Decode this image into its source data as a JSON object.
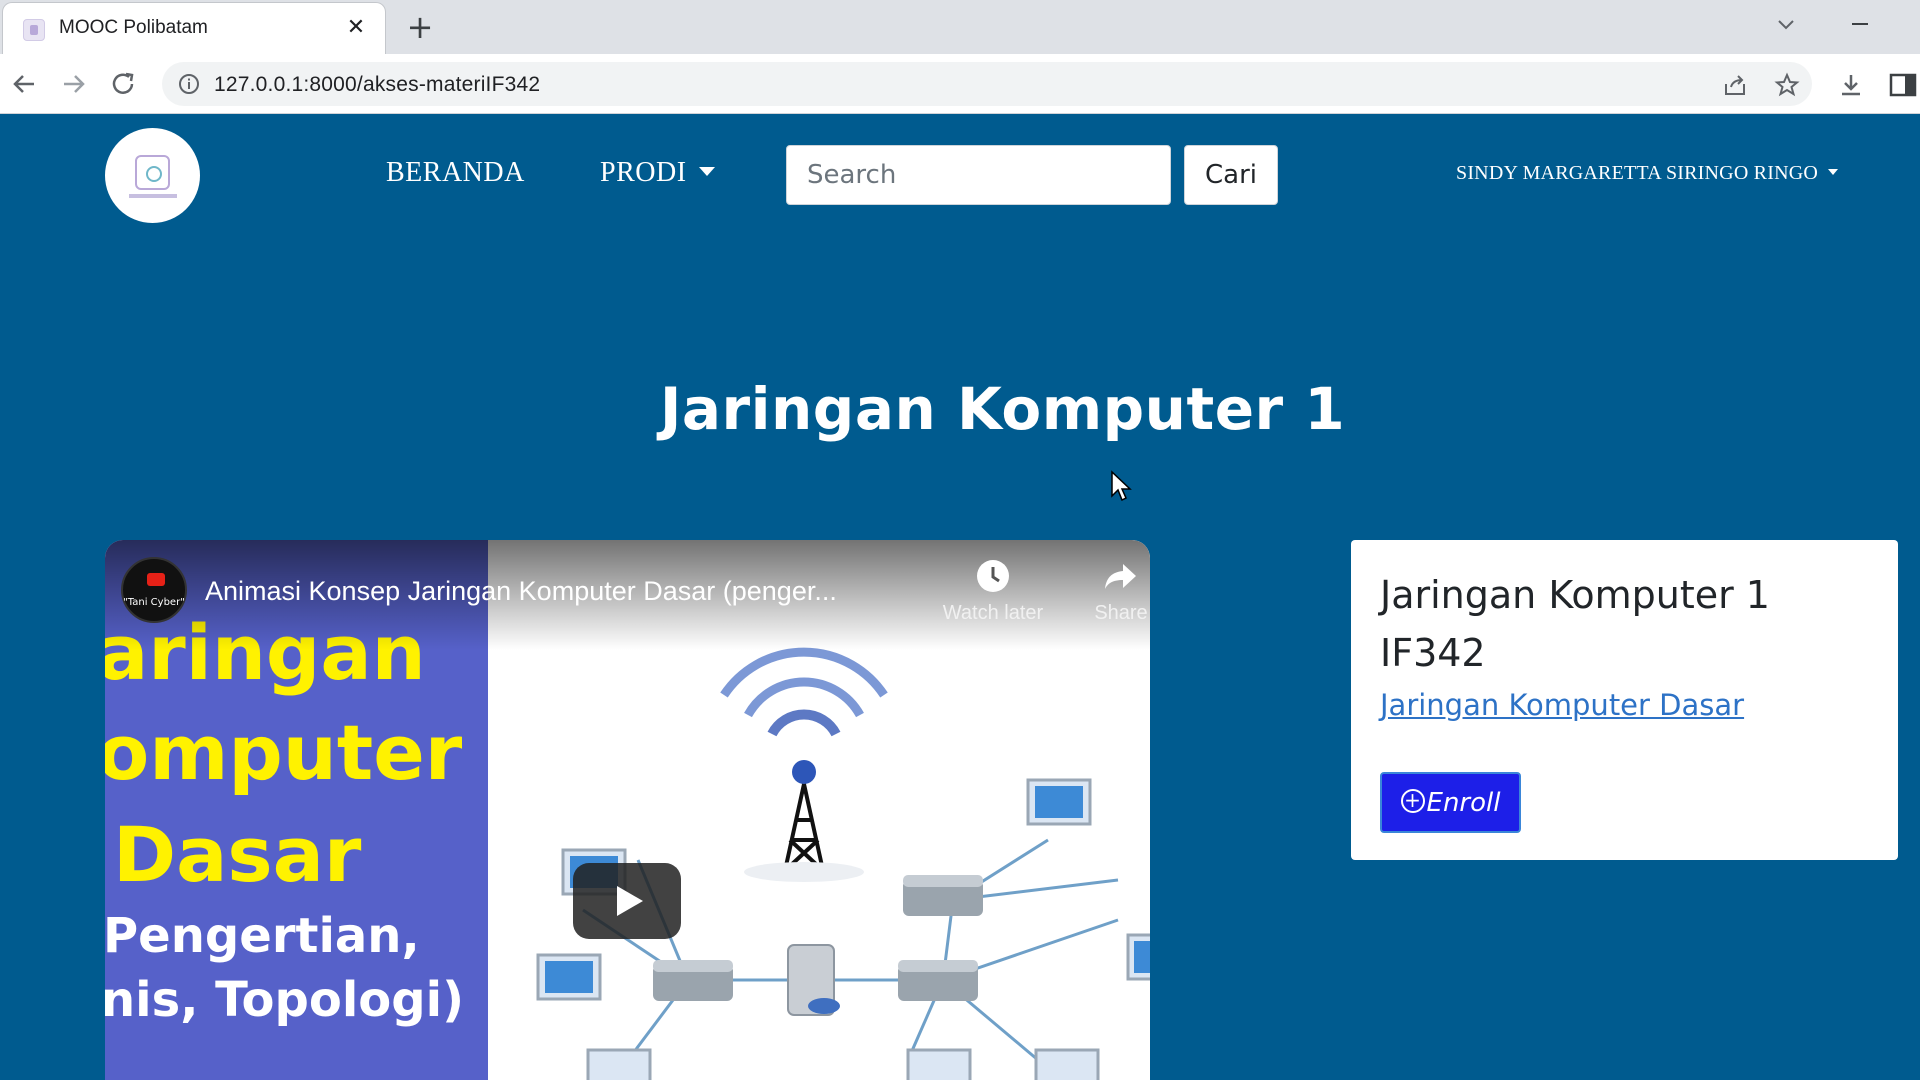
{
  "browser": {
    "tab_title": "MOOC Polibatam",
    "close_label": "✕",
    "new_tab_label": "+",
    "url": "127.0.0.1:8000/akses-materiIF342"
  },
  "navbar": {
    "nav_items": [
      {
        "label": "BERANDA"
      },
      {
        "label": "PRODI"
      }
    ],
    "search_placeholder": "Search",
    "search_button": "Cari",
    "user_name": "SINDY MARGARETTA SIRINGO RINGO"
  },
  "course": {
    "page_title": "Jaringan Komputer 1",
    "card_name": "Jaringan Komputer 1",
    "card_code": "IF342",
    "card_link": "Jaringan Komputer Dasar",
    "enroll_label": "Enroll",
    "enroll_icon": "plus-circle-icon"
  },
  "video": {
    "channel": "\"Tani Cyber\"",
    "title": "Animasi Konsep Jaringan Komputer Dasar (penger...",
    "watch_later": "Watch later",
    "share": "Share",
    "thumb_lines": [
      "aringan",
      "omputer",
      "Dasar",
      "Pengertian,",
      "nis, Topologi)"
    ],
    "colors": {
      "thumb_bg": "#5661c9",
      "highlight": "#fff200"
    }
  },
  "colors": {
    "page_bg": "#005b8f",
    "enroll_bg": "#1d1fe8",
    "link": "#2d72c6"
  }
}
